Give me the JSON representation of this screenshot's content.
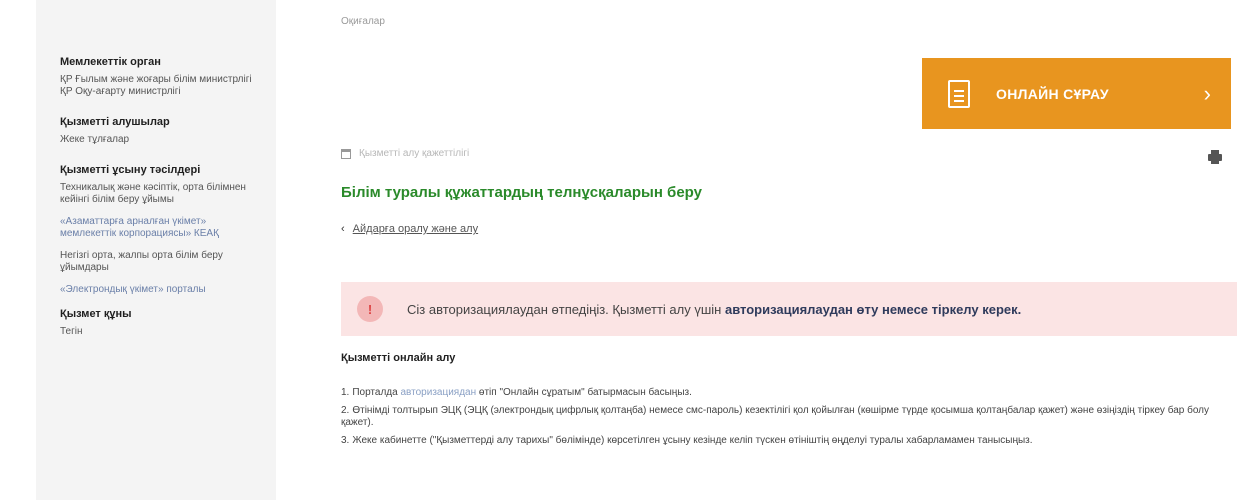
{
  "breadcrumb": "Оқиғалар",
  "sidebar": {
    "org_heading": "Мемлекеттік орган",
    "org_text": "ҚР Ғылым және жоғары білім министрлігі ҚР Оқу-ағарту министрлігі",
    "recipients_heading": "Қызметті алушылар",
    "recipients_text": "Жеке тұлғалар",
    "methods_heading": "Қызметті ұсыну тәсілдері",
    "methods": [
      "Техникалық және кәсіптік, орта білімнен кейінгі білім беру ұйымы",
      "«Азаматтарға арналған үкімет» мемлекеттік корпорациясы» КЕАҚ",
      "Негізгі орта, жалпы орта білім беру ұйымдары",
      "«Электрондық үкімет» порталы"
    ],
    "term_heading": "Қызмет құны",
    "term_text": "Тегін"
  },
  "online_button": {
    "label": "ОНЛАЙН СҰРАУ",
    "icon": "document-icon",
    "arrow": "chevron-right-icon"
  },
  "meta": "Қызметті алу қажеттілігі",
  "page_title": "Білім туралы құжаттардың телнұсқаларын беру",
  "back_link": {
    "arrow": "‹",
    "text": "Айдарға оралу және алу"
  },
  "alert": {
    "icon_glyph": "!",
    "text_plain": "Сіз авторизациялаудан өтпедіңіз. Қызметті алу үшін ",
    "text_bold": "авторизациялаудан өту немесе тіркелу керек."
  },
  "section_title": "Қызметті онлайн алу",
  "steps": [
    {
      "num": "1.",
      "pre": "Порталда ",
      "link": "авторизациядан",
      "post": " өтіп \"Онлайн сұратым\" батырмасын басыңыз."
    },
    {
      "num": "2.",
      "pre": "",
      "link": "",
      "post": "Өтінімді толтырып ЭЦҚ (ЭЦҚ (электрондық цифрлық қолтаңба) немесе смс-пароль) кезектілігі қол қойылған (көшірме түрде қосымша қолтаңбалар қажет) және өзіңіздің тіркеу бар болу қажет)."
    },
    {
      "num": "3.",
      "pre": "",
      "link": "",
      "post": "Жеке кабинетте (\"Қызметтерді алу тарихы\" бөлімінде) көрсетілген ұсыну кезінде келіп түскен өтініштің өңделуі туралы хабарламамен танысыңыз."
    }
  ],
  "colors": {
    "accent": "#e8951f",
    "title_green": "#2a8a2a",
    "alert_bg": "#fbe4e4"
  }
}
